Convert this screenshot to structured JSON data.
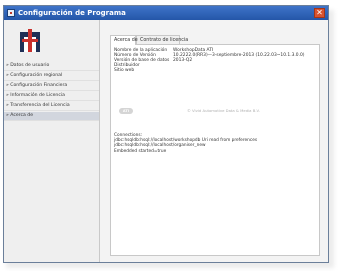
{
  "window": {
    "title": "Configuración de Programa",
    "close_glyph": "✕",
    "icon": "app-icon"
  },
  "sidebar": {
    "logo": "workshopdata-logo",
    "items": [
      {
        "label": "» Datos de usuario"
      },
      {
        "label": "» Configuración regional"
      },
      {
        "label": "» Configuración Financiera"
      },
      {
        "label": "» Información de Licencia"
      },
      {
        "label": "» Transferencia del Licencia"
      },
      {
        "label": "» Acerca de"
      }
    ]
  },
  "tabs": [
    {
      "label": "Acerca de"
    },
    {
      "label": "Contrato de licencia"
    }
  ],
  "about": {
    "rows": [
      {
        "label": "Nombre de la aplicación",
        "value": "WorkshopData ATI"
      },
      {
        "label": "Número de Versión",
        "value": "10.2222.0(RR3)—3-septiembre-2013  (10.22.03~10.1.3.0.0)"
      },
      {
        "label": "Versión de base de datos",
        "value": "2013-Q2"
      },
      {
        "label": "Distribuidor",
        "value": ""
      },
      {
        "label": "Sitio web",
        "value": ""
      }
    ],
    "product_logo_text": "ATI",
    "copyright": "© Vivid Automotive Data & Media B.V.",
    "connections_title": "Connections:",
    "connections": [
      "jdbc:hsqldb:hsql://localhost/workshopdb  Uri read from preferences",
      "jdbc:hsqldb:hsql://localhost/organiser_new",
      "Embedded started=true"
    ]
  }
}
